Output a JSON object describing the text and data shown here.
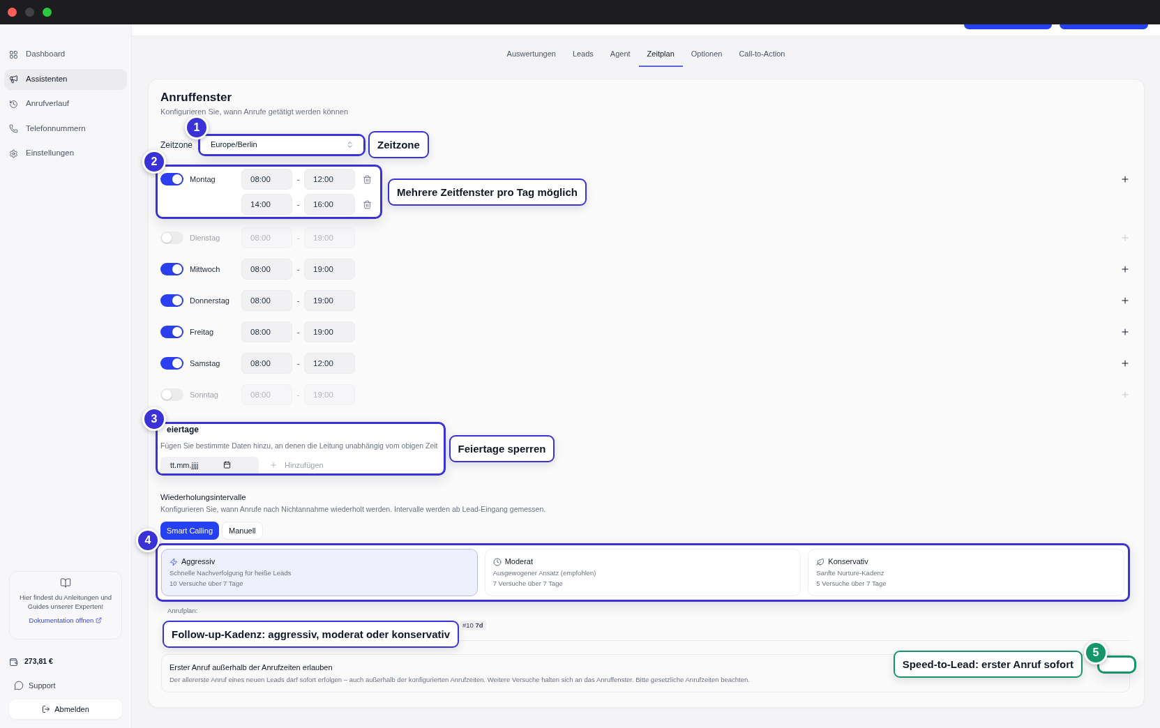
{
  "sidebar": {
    "items": [
      {
        "label": "Dashboard",
        "selected": false
      },
      {
        "label": "Assistenten",
        "selected": true
      },
      {
        "label": "Anrufverlauf",
        "selected": false
      },
      {
        "label": "Telefonnummern",
        "selected": false
      },
      {
        "label": "Einstellungen",
        "selected": false
      }
    ],
    "help_card": {
      "text": "Hier findest du Anleitungen und Guides unserer Experten!",
      "link": "Dokumentation öffnen"
    },
    "balance": "273,81 €",
    "support": "Support",
    "logout": "Abmelden"
  },
  "tabs": [
    {
      "label": "Auswertungen",
      "selected": false
    },
    {
      "label": "Leads",
      "selected": false
    },
    {
      "label": "Agent",
      "selected": false
    },
    {
      "label": "Zeitplan",
      "selected": true
    },
    {
      "label": "Optionen",
      "selected": false
    },
    {
      "label": "Call-to-Action",
      "selected": false
    }
  ],
  "call_window": {
    "title": "Anruffenster",
    "subtitle": "Konfigurieren Sie, wann Anrufe getätigt werden können",
    "timezone": {
      "label": "Zeitzone",
      "value": "Europe/Berlin",
      "annotation": {
        "number": "1",
        "text": "Zeitzone",
        "color": "#3a32d6"
      }
    },
    "days": [
      {
        "name": "Montag",
        "on": true,
        "windows": [
          {
            "from": "08:00",
            "separator": "-",
            "to": "12:00",
            "removable": true
          },
          {
            "from": "14:00",
            "separator": "-",
            "to": "16:00",
            "removable": true
          }
        ],
        "annotation": {
          "number": "2",
          "text": "Mehrere Zeitfenster pro Tag möglich",
          "color": "#3a32d6"
        }
      },
      {
        "name": "Dienstag",
        "on": false,
        "windows": [
          {
            "from": "08:00",
            "separator": "-",
            "to": "19:00"
          }
        ]
      },
      {
        "name": "Mittwoch",
        "on": true,
        "windows": [
          {
            "from": "08:00",
            "separator": "-",
            "to": "19:00"
          }
        ]
      },
      {
        "name": "Donnerstag",
        "on": true,
        "windows": [
          {
            "from": "08:00",
            "separator": "-",
            "to": "19:00"
          }
        ]
      },
      {
        "name": "Freitag",
        "on": true,
        "windows": [
          {
            "from": "08:00",
            "separator": "-",
            "to": "19:00"
          }
        ]
      },
      {
        "name": "Samstag",
        "on": true,
        "windows": [
          {
            "from": "08:00",
            "separator": "-",
            "to": "12:00"
          }
        ]
      },
      {
        "name": "Sonntag",
        "on": false,
        "windows": [
          {
            "from": "08:00",
            "separator": "-",
            "to": "19:00"
          }
        ]
      }
    ]
  },
  "holidays": {
    "title": "eiertage",
    "description": "Fügen Sie bestimmte Daten hinzu, an denen die Leitung unabhängig vom obigen Zeit",
    "date_placeholder": "tt.mm.jjjj",
    "add_label": "Hinzufügen",
    "annotation": {
      "number": "3",
      "text": "Feiertage sperren",
      "color": "#3a32d6"
    }
  },
  "retry": {
    "title": "Wiederholungsintervalle",
    "description": "Konfigurieren Sie, wann Anrufe nach Nichtannahme wiederholt werden. Intervalle werden ab Lead-Eingang gemessen.",
    "modes": [
      {
        "label": "Smart Calling",
        "selected": true
      },
      {
        "label": "Manuell",
        "selected": false
      }
    ],
    "presets": [
      {
        "title": "Aggressiv",
        "description": "Schnelle Nachverfolgung für heiße Leads",
        "attempts": "10 Versuche über 7 Tage",
        "selected": true
      },
      {
        "title": "Moderat",
        "description": "Ausgewogener Ansatz (empfohlen)",
        "attempts": "7 Versuche über 7 Tage",
        "selected": false
      },
      {
        "title": "Konservativ",
        "description": "Sanfte Nurture-Kadenz",
        "attempts": "5 Versuche über 7 Tage",
        "selected": false
      }
    ],
    "presets_annotation": {
      "number": "4",
      "text": "Follow-up-Kadenz: aggressiv, moderat oder konservativ",
      "color": "#3a32d6"
    },
    "plan_label": "Anrufplan:",
    "plan_chips": [
      "#10 **7d**"
    ]
  },
  "first_call": {
    "title": "Erster Anruf außerhalb der Anrufzeiten erlauben",
    "description": "Der allererste Anruf eines neuen Leads darf sofort erfolgen – auch außerhalb der konfigurierten Anrufzeiten. Weitere Versuche halten sich an das Anruffenster. Bitte gesetzliche Anrufzeiten beachten.",
    "annotation": {
      "number": "5",
      "text": "Speed-to-Lead: erster Anruf sofort",
      "color": "#14966b"
    }
  }
}
